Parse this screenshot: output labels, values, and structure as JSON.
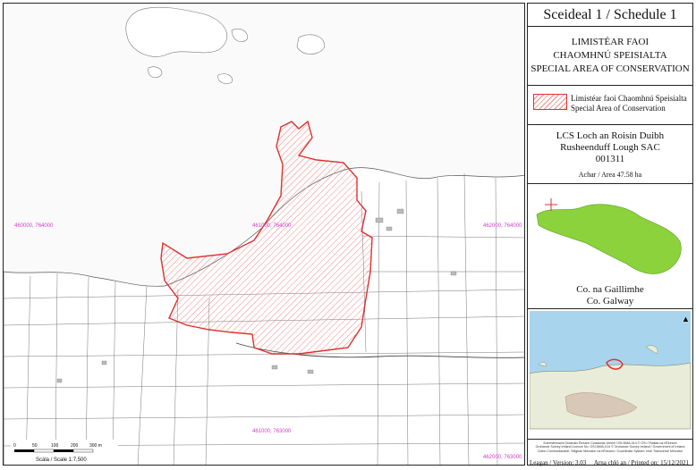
{
  "panel": {
    "title": "Sceideal 1 / Schedule 1",
    "sac_type_irish_line1": "LIMISTÉAR FAOI",
    "sac_type_irish_line2": "CHAOMHNÚ SPEISIALTA",
    "sac_type_english": "SPECIAL AREA OF CONSERVATION",
    "legend_irish": "Limistéar faoi Chaomhnú Speisialta",
    "legend_english": "Special Area of Conservation",
    "sac_name_irish": "LCS Loch an Roisín Duibh",
    "sac_name_english": "Rusheenduff Lough SAC",
    "site_code": "001311",
    "area": "Achar / Area 47.58 ha",
    "county_irish": "Co. na Gaillimhe",
    "county_english": "Co. Galway",
    "copyright_line1": "Suirbhéireacht Ordanáis Éireann Ceadúnas Uimhir OSI-NMA-014 © OSi / Rialtas na hÉireann",
    "copyright_line2": "Ordnance Survey Ireland Licence No. OSI-NMA-014 © Ordnance Survey Ireland / Government of Ireland",
    "copyright_line3": "Clann Comhordanáidí: Teilgean Mercator na hÉireann / Coordinate System: Irish Transverse Mercator",
    "version": "Leagan / Version: 3.03",
    "printed_on": "Arna chló an / Printed on: 15/12/2021"
  },
  "map": {
    "grid_labels": [
      "460000, 764000",
      "461000, 764000",
      "462000, 764000",
      "461000, 763000",
      "462000, 763000"
    ],
    "scale_text": "Scála / Scale 1:7,500",
    "scale_ticks": [
      "0",
      "50",
      "100",
      "200",
      "300 m"
    ],
    "colors": {
      "sac_boundary": "#e03030",
      "grid_labels": "#d23cc8",
      "land_lines": "#555555"
    }
  }
}
